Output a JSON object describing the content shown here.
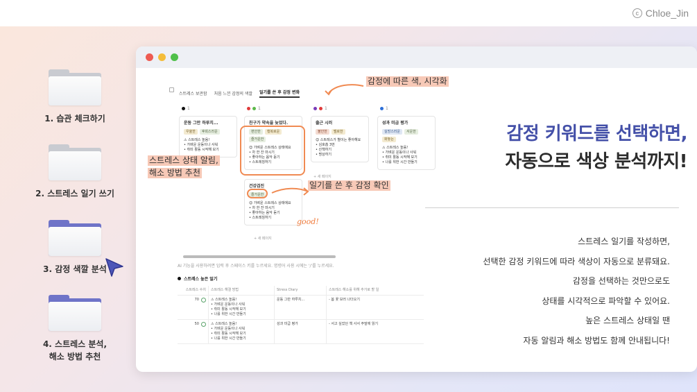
{
  "brand": {
    "mark": "c",
    "name": "Chloe_Jin"
  },
  "folders": [
    {
      "label": "1. 습관 체크하기",
      "color": "grey"
    },
    {
      "label": "2. 스트레스 일기 쓰기",
      "color": "grey"
    },
    {
      "label": "3. 감정 색깔 분석",
      "color": "blue"
    },
    {
      "label_line1": "4. 스트레스 분석,",
      "label_line2": "해소 방법 추천",
      "color": "blue"
    }
  ],
  "window": {
    "tabs": [
      "스트레스 보관함",
      "처음 느낀 감정의 색깔",
      "일기를 쓴 후 감정 변화"
    ],
    "columns": [
      {
        "head": "1"
      },
      {
        "head": "1"
      },
      {
        "head": "1"
      },
      {
        "head": "1"
      }
    ],
    "cards": [
      {
        "title": "운동 그만 하루치...",
        "tags": [
          "우울한",
          "후회스러운"
        ],
        "lines": [
          "⚠ 스트레스 높음!",
          "• 가벼운 운동이나 사워",
          "• 취미 활동 시작해 보기"
        ]
      },
      {
        "title": "친구가 약속을 늦었다.",
        "tags": [
          "편안한",
          "행복로운",
          "즐거운한"
        ],
        "lines": [
          "😊 가벼운 스트레스 상태에요",
          "• 차 한 잔 마시기",
          "• 좋아하는 음악 듣기",
          "• 스트레칭하기"
        ]
      },
      {
        "title": "출근 시러",
        "tags": [
          "불안한",
          "멜로한"
        ],
        "lines": [
          "😊 스트레스가 별이는 좋아해요",
          "• 심호흡 3번",
          "• 산책하기",
          "• 명상하기"
        ]
      },
      {
        "title": "성과 미급 평가",
        "tags": [
          "실망스러운",
          "서운한",
          "화놓는"
        ],
        "lines": [
          "⚠ 스트레스 높음!",
          "• 가벼운 운동이나 사워",
          "• 취미 활동 시작해 보기",
          "• 나를 위한 시간 만들기"
        ]
      },
      {
        "title": "건강검진",
        "tags": [
          "즐거운한"
        ],
        "lines": [
          "😊 가벼운 스트레스 상태에요",
          "• 차 한 잔 마시기",
          "• 좋아하는 음악 듣기",
          "• 스트레칭하기"
        ]
      }
    ],
    "add_label": "+ 새 페이지",
    "ai_hint": "AI 기능을 사용하려면 입력 후 스페이스 키를 누르세요. 명령어 사용 시에는 '/'를 누르세요.",
    "db_title": "스트레스 높은 일기",
    "table_headers": [
      "스트레스 수치",
      "스트레스 해결 방법",
      "Stress Diary",
      "스트레스 해소를 위해 추가로 할 일"
    ],
    "table_rows": [
      {
        "score": "70",
        "lines": [
          "⚠ 스트레스 높음!",
          "• 가벼운 운동이나 사워",
          "• 취미 활동 시작해 보기",
          "• 나를 위한 시간 만들기"
        ],
        "diary": "운동 그만 하루치...",
        "todo": "- 봄 꽃 보러 나더오기"
      },
      {
        "score": "50",
        "lines": [
          "⚠ 스트레스 높음!",
          "• 가벼운 운동이나 사워",
          "• 취미 활동 시작해 보기",
          "• 나를 위한 시간 만들기"
        ],
        "diary": "성과 미급 평가",
        "todo": "- 서고 싶었던 책 사서 주말에 읽기"
      }
    ]
  },
  "callouts": {
    "color_viz": "감정에 따른 색, 시각화",
    "alert_line1": "스트레스 상태 알림,",
    "alert_line2": "해소 방법 추천",
    "after_diary": "일기를 쓴 후 감정 확인",
    "good": "good!"
  },
  "headline": {
    "line1": "감정 키워드를 선택하면,",
    "line2": "자동으로 색상 분석까지!"
  },
  "description": [
    "스트레스 일기를 작성하면,",
    "선택한 감정 키워드에 따라 색상이 자동으로 분류돼요.",
    "감정을 선택하는 것만으로도",
    "상태를 시각적으로 파악할 수 있어요.",
    "높은 스트레스 상태일 땐",
    "자동 알림과 해소 방법도 함께 안내됩니다!"
  ],
  "colors": {
    "accent": "#4450a8",
    "highlight": "#f7c9b7",
    "circle": "#f08a52"
  }
}
